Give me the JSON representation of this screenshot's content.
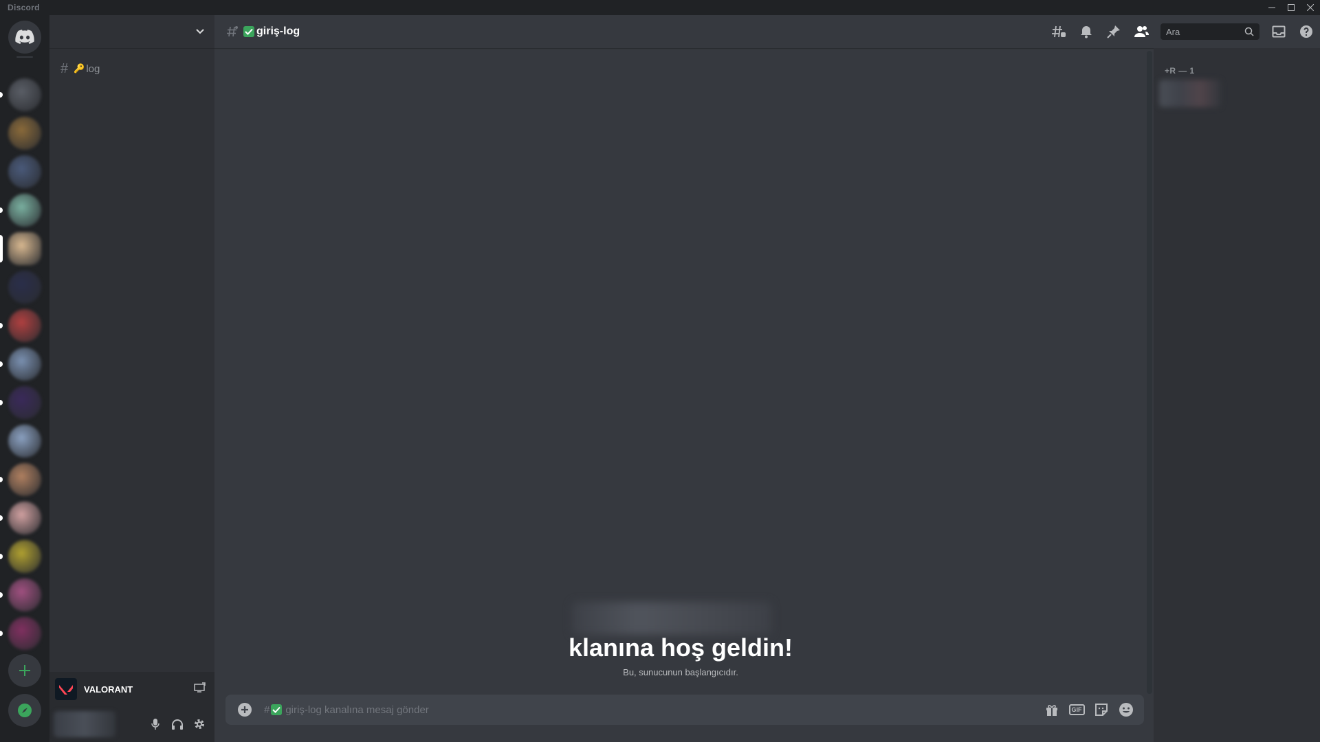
{
  "window": {
    "app_name": "Discord"
  },
  "servers": [
    {
      "color": "#5a5e66",
      "unread": true
    },
    {
      "color": "#8a6a3a",
      "unread": false
    },
    {
      "color": "#4a5a7a",
      "unread": false
    },
    {
      "color": "#7ab0a0",
      "unread": true
    },
    {
      "color": "#d8b890",
      "unread": false,
      "selected": true
    },
    {
      "color": "#2a2e4a",
      "unread": false
    },
    {
      "color": "#b04040",
      "unread": true
    },
    {
      "color": "#7a90b0",
      "unread": true
    },
    {
      "color": "#3a2a5a",
      "unread": true
    },
    {
      "color": "#8aa0c0",
      "unread": false
    },
    {
      "color": "#b08060",
      "unread": true
    },
    {
      "color": "#d0a0a0",
      "unread": true
    },
    {
      "color": "#b0a030",
      "unread": true
    },
    {
      "color": "#a05080",
      "unread": true
    },
    {
      "color": "#803060",
      "unread": true
    }
  ],
  "sidebar": {
    "channels": [
      {
        "emoji": "🔑",
        "name": "log"
      }
    ]
  },
  "activity": {
    "game": "VALORANT"
  },
  "channel": {
    "emoji_check": "✓",
    "name": "giriş-log"
  },
  "search": {
    "placeholder": "Ara"
  },
  "welcome": {
    "title": "klanına hoş geldin!",
    "subtitle": "Bu, sunucunun başlangıcıdır."
  },
  "composer": {
    "placeholder": "giriş-log kanalına mesaj gönder"
  },
  "members": {
    "role_header": "+R — 1"
  },
  "colors": {
    "accent": "#5865f2",
    "green": "#3ba55c",
    "explore": "#3ba55c"
  }
}
